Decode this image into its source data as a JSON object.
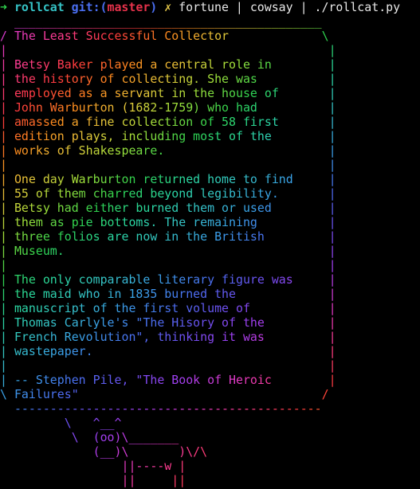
{
  "window": {
    "background": "#000000"
  },
  "prompt": {
    "arrow": "➜",
    "directory": "rollcat",
    "git_label": "git:(",
    "branch": "master",
    "git_close": ")",
    "dirty_marker": "✗",
    "command": "fortune | cowsay | ./rollcat.py",
    "colors": {
      "arrow": "#2fd24d",
      "directory": "#35c3c6",
      "git_label": "#4a6ef0",
      "branch": "#e6324b",
      "dirty_marker": "#e6c94a",
      "command": "#e8e8e8"
    }
  },
  "output_lines": [
    "  ___________________________________________",
    "/ The Least Successful Collector             \\",
    "|                                             |",
    "| Betsy Baker played a central role in        |",
    "| the history of collecting. She was          |",
    "| employed as a servant in the house of       |",
    "| John Warburton (1682-1759) who had          |",
    "| amassed a fine collection of 58 first       |",
    "| edition plays, including most of the        |",
    "| works of Shakespeare.                       |",
    "|                                             |",
    "| One day Warburton returned home to find     |",
    "| 55 of them charred beyond legibility.       |",
    "| Betsy had either burned them or used        |",
    "| them as pie bottoms. The remaining          |",
    "| three folios are now in the British         |",
    "| Museum.                                     |",
    "|                                             |",
    "| The only comparable literary figure was     |",
    "| the maid who in 1835 burned the             |",
    "| manuscript of the first volume of           |",
    "| Thomas Carlyle's \"The Hisory of the         |",
    "| French Revolution\", thinking it was         |",
    "| wastepaper.                                 |",
    "|                                             |",
    "| -- Stephen Pile, \"The Book of Heroic        |",
    "\\ Failures\"                                  /",
    "  -------------------------------------------",
    "         \\   ^__^",
    "          \\  (oo)\\_______",
    "             (__)\\       )\\/\\",
    "                 ||----w |",
    "                 ||     ||"
  ],
  "rainbow_palette": [
    "#ff3b3b",
    "#ff8a1e",
    "#e6c63a",
    "#9fe03a",
    "#2fd24d",
    "#2ad8a0",
    "#35c3c6",
    "#3aa0e8",
    "#4a6ef0",
    "#6e4ff0",
    "#a33ef0",
    "#e03ac8",
    "#ff3b8a"
  ]
}
